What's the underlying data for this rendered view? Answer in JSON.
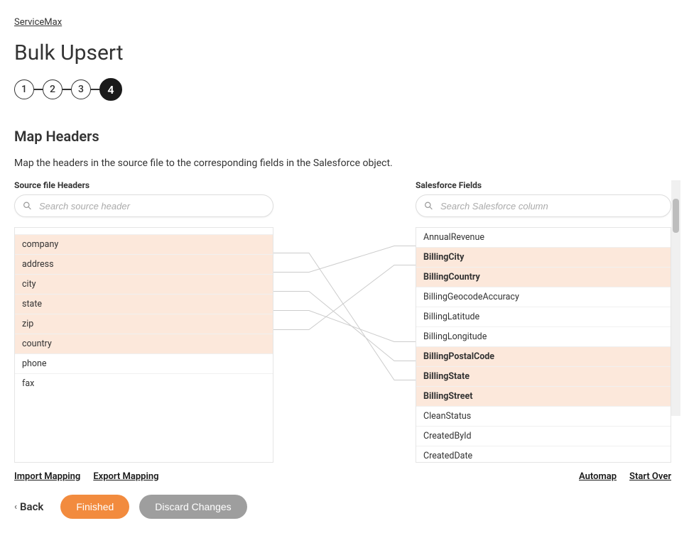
{
  "breadcrumb": "ServiceMax",
  "page_title": "Bulk Upsert",
  "steps": [
    "1",
    "2",
    "3",
    "4"
  ],
  "active_step_index": 3,
  "section_title": "Map Headers",
  "section_desc": "Map the headers in the source file to the corresponding fields in the Salesforce object.",
  "left": {
    "label": "Source file Headers",
    "search_placeholder": "Search source header",
    "items": [
      {
        "label": "company",
        "mapped": true
      },
      {
        "label": "address",
        "mapped": true
      },
      {
        "label": "city",
        "mapped": true
      },
      {
        "label": "state",
        "mapped": true
      },
      {
        "label": "zip",
        "mapped": true
      },
      {
        "label": "country",
        "mapped": true
      },
      {
        "label": "phone",
        "mapped": false
      },
      {
        "label": "fax",
        "mapped": false
      }
    ]
  },
  "right": {
    "label": "Salesforce Fields",
    "search_placeholder": "Search Salesforce column",
    "items": [
      {
        "label": "AnnualRevenue",
        "mapped": false
      },
      {
        "label": "BillingCity",
        "mapped": true
      },
      {
        "label": "BillingCountry",
        "mapped": true
      },
      {
        "label": "BillingGeocodeAccuracy",
        "mapped": false
      },
      {
        "label": "BillingLatitude",
        "mapped": false
      },
      {
        "label": "BillingLongitude",
        "mapped": false
      },
      {
        "label": "BillingPostalCode",
        "mapped": true
      },
      {
        "label": "BillingState",
        "mapped": true
      },
      {
        "label": "BillingStreet",
        "mapped": true
      },
      {
        "label": "CleanStatus",
        "mapped": false
      },
      {
        "label": "CreatedById",
        "mapped": false
      },
      {
        "label": "CreatedDate",
        "mapped": false
      }
    ]
  },
  "links": {
    "import": "Import Mapping",
    "export": "Export Mapping",
    "automap": "Automap",
    "startover": "Start Over"
  },
  "footer": {
    "back": "Back",
    "finished": "Finished",
    "discard": "Discard Changes"
  },
  "mappings": [
    {
      "from": 1,
      "to": 8
    },
    {
      "from": 2,
      "to": 1
    },
    {
      "from": 3,
      "to": 7
    },
    {
      "from": 4,
      "to": 6
    },
    {
      "from": 5,
      "to": 2
    }
  ]
}
